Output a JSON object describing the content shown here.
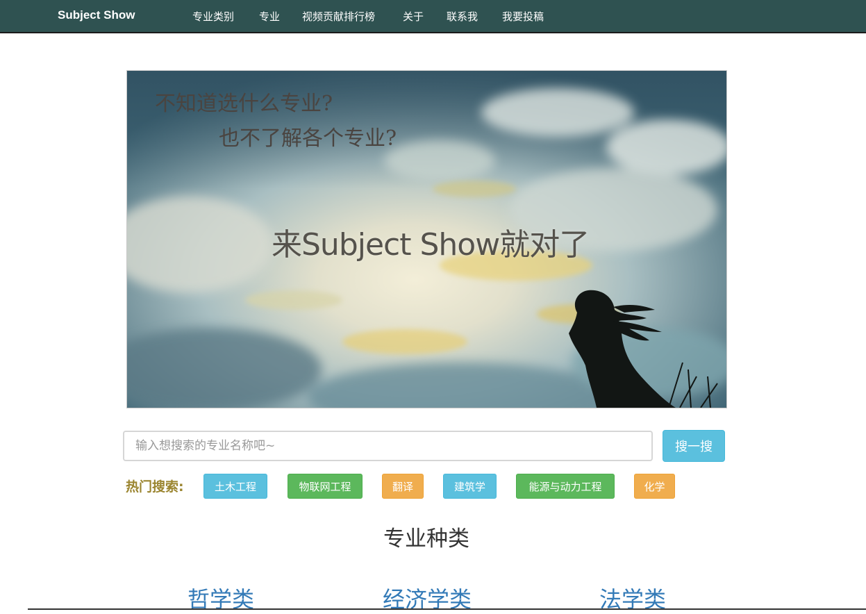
{
  "navbar": {
    "brand": "Subject Show",
    "items": [
      {
        "label": "专业类别"
      },
      {
        "label": "专业"
      },
      {
        "label": "视频贡献排行榜"
      },
      {
        "label": "关于"
      },
      {
        "label": "联系我"
      },
      {
        "label": "我要投稿"
      }
    ],
    "background": "#2f5251"
  },
  "banner": {
    "line1": "不知道选什么专业?",
    "line2": "也不了解各个专业?",
    "tagline": "来Subject Show就对了"
  },
  "search": {
    "placeholder": "输入想搜索的专业名称吧~",
    "button_label": "搜一搜"
  },
  "hot_search": {
    "label": "热门搜索:",
    "tags": [
      {
        "label": "土木工程",
        "color": "#5bc0de"
      },
      {
        "label": "物联网工程",
        "color": "#5cb85c"
      },
      {
        "label": "翻译",
        "color": "#f0ad4e"
      },
      {
        "label": "建筑学",
        "color": "#5bc0de"
      },
      {
        "label": "能源与动力工程",
        "color": "#5cb85c"
      },
      {
        "label": "化学",
        "color": "#f0ad4e"
      }
    ]
  },
  "categories_section": {
    "title": "专业种类",
    "items": [
      {
        "label": "哲学类"
      },
      {
        "label": "经济学类"
      },
      {
        "label": "法学类"
      }
    ]
  }
}
